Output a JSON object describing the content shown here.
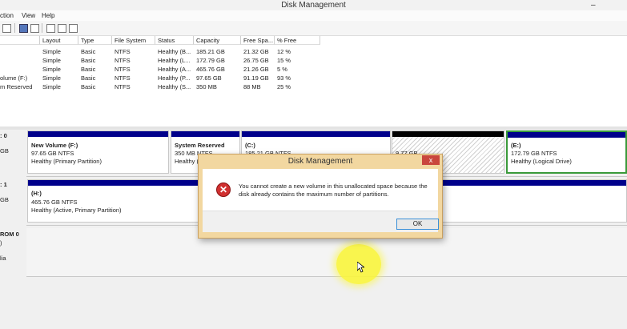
{
  "window": {
    "title": "Disk Management",
    "minimize_glyph": "–"
  },
  "menu": [
    "ction",
    "View",
    "Help"
  ],
  "toolbar_icons": [
    "back-icon",
    "properties-icon",
    "help-icon",
    "console-icon",
    "rescan-icon",
    "settings-icon"
  ],
  "volume_table": {
    "columns": [
      "Layout",
      "Type",
      "File System",
      "Status",
      "Capacity",
      "Free Spa...",
      "% Free"
    ],
    "rows": [
      {
        "volume": "",
        "layout": "Simple",
        "type": "Basic",
        "fs": "NTFS",
        "status": "Healthy (B...",
        "capacity": "185.21 GB",
        "free": "21.32 GB",
        "pct": "12 %"
      },
      {
        "volume": "",
        "layout": "Simple",
        "type": "Basic",
        "fs": "NTFS",
        "status": "Healthy (L...",
        "capacity": "172.79 GB",
        "free": "26.75 GB",
        "pct": "15 %"
      },
      {
        "volume": "",
        "layout": "Simple",
        "type": "Basic",
        "fs": "NTFS",
        "status": "Healthy (A...",
        "capacity": "465.76 GB",
        "free": "21.26 GB",
        "pct": "5 %"
      },
      {
        "volume": "olume (F:)",
        "layout": "Simple",
        "type": "Basic",
        "fs": "NTFS",
        "status": "Healthy (P...",
        "capacity": "97.65 GB",
        "free": "91.19 GB",
        "pct": "93 %"
      },
      {
        "volume": "m Reserved",
        "layout": "Simple",
        "type": "Basic",
        "fs": "NTFS",
        "status": "Healthy (S...",
        "capacity": "350 MB",
        "free": "88 MB",
        "pct": "25 %"
      }
    ]
  },
  "disks": {
    "disk0": {
      "header": [
        ": 0",
        "GB"
      ],
      "partitions": {
        "f": {
          "name": "New Volume  (F:)",
          "size": "97.65 GB NTFS",
          "status": "Healthy (Primary Partition)"
        },
        "sr": {
          "name": "System Reserved",
          "size": "350 MB NTFS",
          "status": "Healthy (S"
        },
        "c": {
          "name": "(C:)",
          "size": "185.21 GB NTFS"
        },
        "unalloc": {
          "size": "9.77 GB"
        },
        "e": {
          "name": "(E:)",
          "size": "172.79 GB NTFS",
          "status": "Healthy (Logical Drive)"
        }
      }
    },
    "disk1": {
      "header": [
        ": 1",
        "GB"
      ],
      "partitions": {
        "h": {
          "name": "(H:)",
          "size": "465.76 GB NTFS",
          "status": "Healthy (Active, Primary Partition)"
        }
      }
    },
    "cdrom": {
      "header": [
        "ROM 0",
        ")",
        "lia"
      ]
    }
  },
  "dialog": {
    "title": "Disk Management",
    "close": "x",
    "icon": "error-icon",
    "error_glyph": "✕",
    "message": "You cannot create a new volume in this unallocated space because the disk already contains the maximum number of partitions.",
    "ok_label": "OK"
  },
  "colors": {
    "partition_bar": "#00008b",
    "error": "#d03030",
    "dialog_frame": "#f2d7a0",
    "highlight": "#faf53c"
  }
}
